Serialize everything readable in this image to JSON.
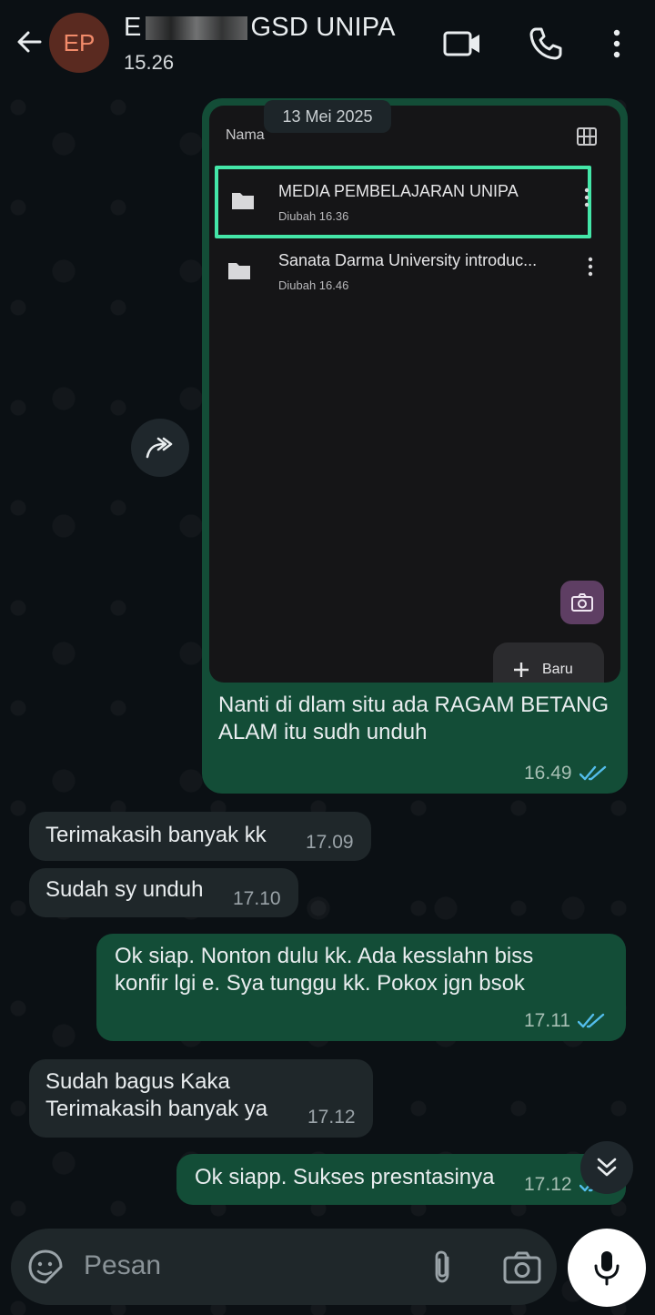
{
  "header": {
    "avatar_initials": "EP",
    "contact_name_prefix": "E",
    "contact_name_suffix": "GSD UNIPA",
    "last_seen": "15.26"
  },
  "image_message": {
    "date_pill": "13 Mei 2025",
    "screenshot": {
      "column_header": "Nama",
      "folders": [
        {
          "title": "MEDIA PEMBELAJARAN UNIPA",
          "modified": "Diubah 16.36",
          "highlighted": true
        },
        {
          "title": "Sanata Darma University introduc...",
          "modified": "Diubah 16.46",
          "highlighted": false
        }
      ],
      "new_button_label": "Baru"
    },
    "caption": "Nanti di dlam situ ada RAGAM BETANG ALAM itu sudh unduh",
    "time": "16.49"
  },
  "messages": [
    {
      "direction": "in",
      "text_lines": [
        "Terimakasih banyak kk"
      ],
      "time": "17.09"
    },
    {
      "direction": "in",
      "text_lines": [
        "Sudah sy unduh"
      ],
      "time": "17.10"
    },
    {
      "direction": "out",
      "text_lines": [
        "Ok siap. Nonton dulu kk. Ada kesslahn biss",
        "konfir lgi e. Sya tunggu kk. Pokox jgn bsok"
      ],
      "time": "17.11"
    },
    {
      "direction": "in",
      "text_lines": [
        "Sudah bagus Kaka",
        "Terimakasih banyak ya"
      ],
      "time": "17.12"
    },
    {
      "direction": "out",
      "text_lines": [
        "Ok siapp. Sukses presntasinya"
      ],
      "time": "17.12"
    }
  ],
  "input": {
    "placeholder": "Pesan"
  },
  "colors": {
    "out_bubble": "#134d37",
    "in_bubble": "#1f272a",
    "read_tick": "#53bdeb",
    "highlight": "#44e6a8"
  }
}
